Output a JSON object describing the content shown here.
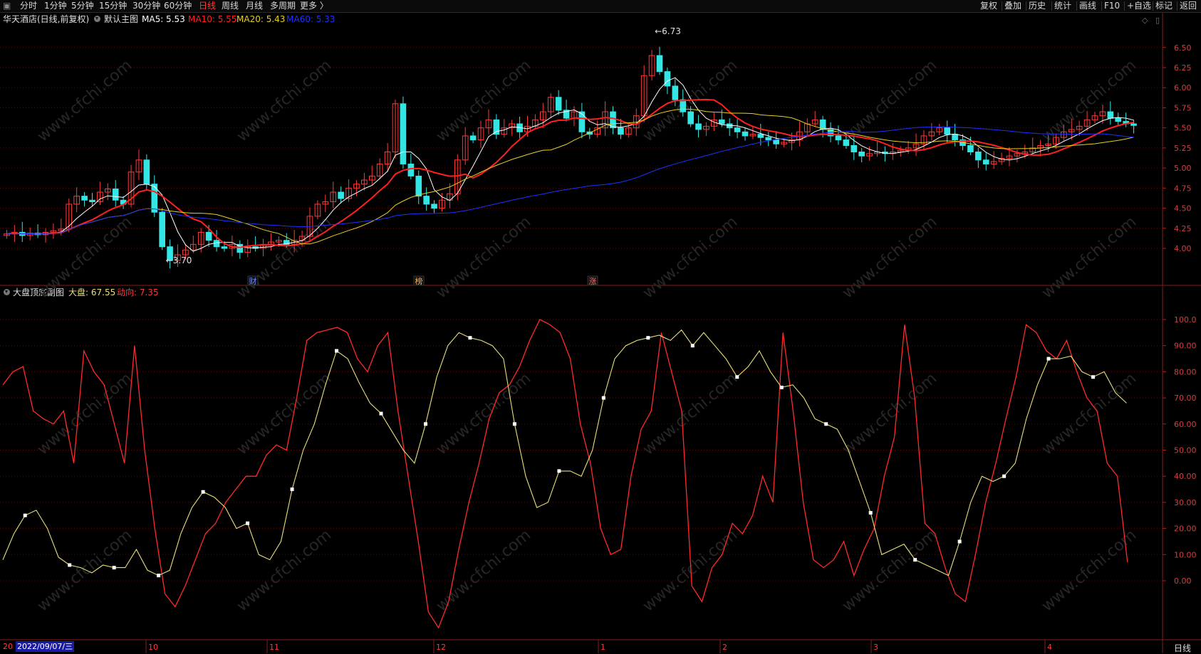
{
  "toolbar": {
    "left_items": [
      {
        "label": "分时",
        "active": false
      },
      {
        "label": "1分钟",
        "active": false
      },
      {
        "label": "5分钟",
        "active": false
      },
      {
        "label": "15分钟",
        "active": false
      },
      {
        "label": "30分钟",
        "active": false
      },
      {
        "label": "60分钟",
        "active": false
      },
      {
        "label": "日线",
        "active": true
      },
      {
        "label": "周线",
        "active": false
      },
      {
        "label": "月线",
        "active": false
      },
      {
        "label": "多周期",
        "active": false
      },
      {
        "label": "更多 〉",
        "active": false
      }
    ],
    "right_items": [
      "复权",
      "叠加",
      "历史",
      "统计",
      "画线",
      "F10",
      "+自选",
      "标记",
      "返回"
    ]
  },
  "main_chart": {
    "title": "华天酒店(日线,前复权)",
    "template": "默认主图",
    "ma": [
      {
        "label": "MA5: 5.53",
        "color": "#ffffff"
      },
      {
        "label": "MA10: 5.55",
        "color": "#ff2020"
      },
      {
        "label": "MA20: 5.43",
        "color": "#e8d020"
      },
      {
        "label": "MA60: 5.33",
        "color": "#2030ff"
      }
    ],
    "y_ticks": [
      "6.50",
      "6.25",
      "6.00",
      "5.75",
      "5.50",
      "5.25",
      "5.00",
      "4.75",
      "4.50",
      "4.25",
      "4.00"
    ],
    "high_label": "6.73",
    "low_label": "3.70",
    "event_markers": [
      "财",
      "榜",
      "涨"
    ]
  },
  "sub_chart": {
    "title": "大盘顶底副图",
    "values": [
      {
        "label": "大盘: 67.55",
        "color": "#e8e07a"
      },
      {
        "label": "动向: 7.35",
        "color": "#ff3a3a"
      }
    ],
    "y_ticks": [
      "100.0",
      "90.00",
      "80.00",
      "70.00",
      "60.00",
      "50.00",
      "40.00",
      "30.00",
      "20.00",
      "10.00",
      "0.00"
    ]
  },
  "x_axis": {
    "cursor_date": "2022/09/07/三",
    "leading_label": "20",
    "months": [
      "10",
      "11",
      "12",
      "1",
      "2",
      "3",
      "4"
    ],
    "period": "日线"
  },
  "watermark": "www.cfchi.com",
  "chart_data": [
    {
      "type": "candlestick",
      "title": "华天酒店(日线,前复权)",
      "ylim": [
        3.7,
        6.73
      ],
      "high": 6.73,
      "low": 3.7,
      "last_ma": {
        "MA5": 5.53,
        "MA10": 5.55,
        "MA20": 5.43,
        "MA60": 5.33
      },
      "close_approx": [
        4.18,
        4.2,
        4.16,
        4.19,
        4.17,
        4.2,
        4.22,
        4.24,
        4.55,
        4.65,
        4.6,
        4.58,
        4.7,
        4.74,
        4.6,
        4.55,
        4.95,
        5.1,
        4.8,
        4.45,
        4.02,
        3.85,
        3.92,
        3.98,
        4.05,
        4.2,
        4.1,
        4.02,
        4.0,
        4.05,
        3.95,
        4.02,
        4.0,
        4.05,
        4.08,
        4.1,
        4.05,
        4.1,
        4.15,
        4.4,
        4.55,
        4.58,
        4.7,
        4.62,
        4.75,
        4.8,
        4.85,
        4.9,
        5.05,
        5.2,
        5.8,
        5.05,
        4.9,
        4.65,
        4.55,
        4.5,
        4.6,
        4.68,
        5.1,
        5.4,
        5.35,
        5.5,
        5.6,
        5.42,
        5.5,
        5.55,
        5.45,
        5.52,
        5.6,
        5.7,
        5.88,
        5.72,
        5.62,
        5.7,
        5.45,
        5.42,
        5.5,
        5.7,
        5.5,
        5.42,
        5.5,
        5.65,
        6.15,
        6.4,
        6.2,
        6.02,
        5.85,
        5.7,
        5.55,
        5.48,
        5.52,
        5.6,
        5.55,
        5.5,
        5.45,
        5.4,
        5.42,
        5.38,
        5.35,
        5.3,
        5.32,
        5.35,
        5.45,
        5.55,
        5.6,
        5.48,
        5.4,
        5.35,
        5.28,
        5.2,
        5.15,
        5.18,
        5.2,
        5.18,
        5.2,
        5.22,
        5.25,
        5.3,
        5.4,
        5.45,
        5.5,
        5.42,
        5.35,
        5.28,
        5.2,
        5.1,
        5.05,
        5.08,
        5.12,
        5.15,
        5.18,
        5.2,
        5.25,
        5.28,
        5.3,
        5.38,
        5.45,
        5.48,
        5.52,
        5.6,
        5.65,
        5.7,
        5.62,
        5.58,
        5.55,
        5.53
      ]
    },
    {
      "type": "line",
      "title": "大盘顶底副图",
      "ylim": [
        0,
        100
      ],
      "series": [
        {
          "name": "大盘",
          "last": 67.55,
          "values": [
            8,
            18,
            25,
            27,
            20,
            9,
            6,
            5,
            3,
            6,
            5,
            5,
            12,
            4,
            2,
            4,
            18,
            28,
            34,
            32,
            28,
            20,
            22,
            10,
            8,
            15,
            35,
            50,
            60,
            75,
            88,
            85,
            76,
            68,
            64,
            57,
            50,
            45,
            60,
            78,
            90,
            95,
            93,
            92,
            90,
            85,
            60,
            40,
            28,
            30,
            42,
            42,
            40,
            50,
            70,
            85,
            90,
            92,
            93,
            94,
            92,
            96,
            90,
            95,
            90,
            85,
            78,
            82,
            88,
            80,
            74,
            75,
            70,
            62,
            60,
            58,
            50,
            38,
            26,
            10,
            12,
            14,
            8,
            6,
            4,
            2,
            15,
            30,
            40,
            38,
            40,
            45,
            62,
            75,
            85,
            85,
            86,
            80,
            78,
            80,
            72,
            68
          ]
        },
        {
          "name": "动向",
          "last": 7.35,
          "values": [
            75,
            80,
            82,
            65,
            62,
            60,
            65,
            45,
            88,
            80,
            75,
            60,
            45,
            90,
            50,
            20,
            -5,
            -10,
            -2,
            8,
            18,
            22,
            30,
            35,
            40,
            40,
            48,
            52,
            50,
            70,
            92,
            95,
            96,
            97,
            95,
            85,
            80,
            90,
            95,
            65,
            40,
            15,
            -12,
            -18,
            -8,
            12,
            30,
            45,
            62,
            72,
            75,
            82,
            92,
            100,
            98,
            95,
            85,
            60,
            45,
            20,
            10,
            12,
            40,
            58,
            65,
            95,
            80,
            65,
            -2,
            -8,
            5,
            10,
            22,
            18,
            25,
            40,
            30,
            95,
            65,
            30,
            8,
            5,
            8,
            15,
            2,
            12,
            20,
            40,
            55,
            98,
            70,
            22,
            18,
            5,
            -5,
            -8,
            10,
            30,
            45,
            62,
            78,
            98,
            95,
            88,
            85,
            92,
            80,
            70,
            65,
            45,
            40,
            7
          ]
        }
      ]
    }
  ]
}
